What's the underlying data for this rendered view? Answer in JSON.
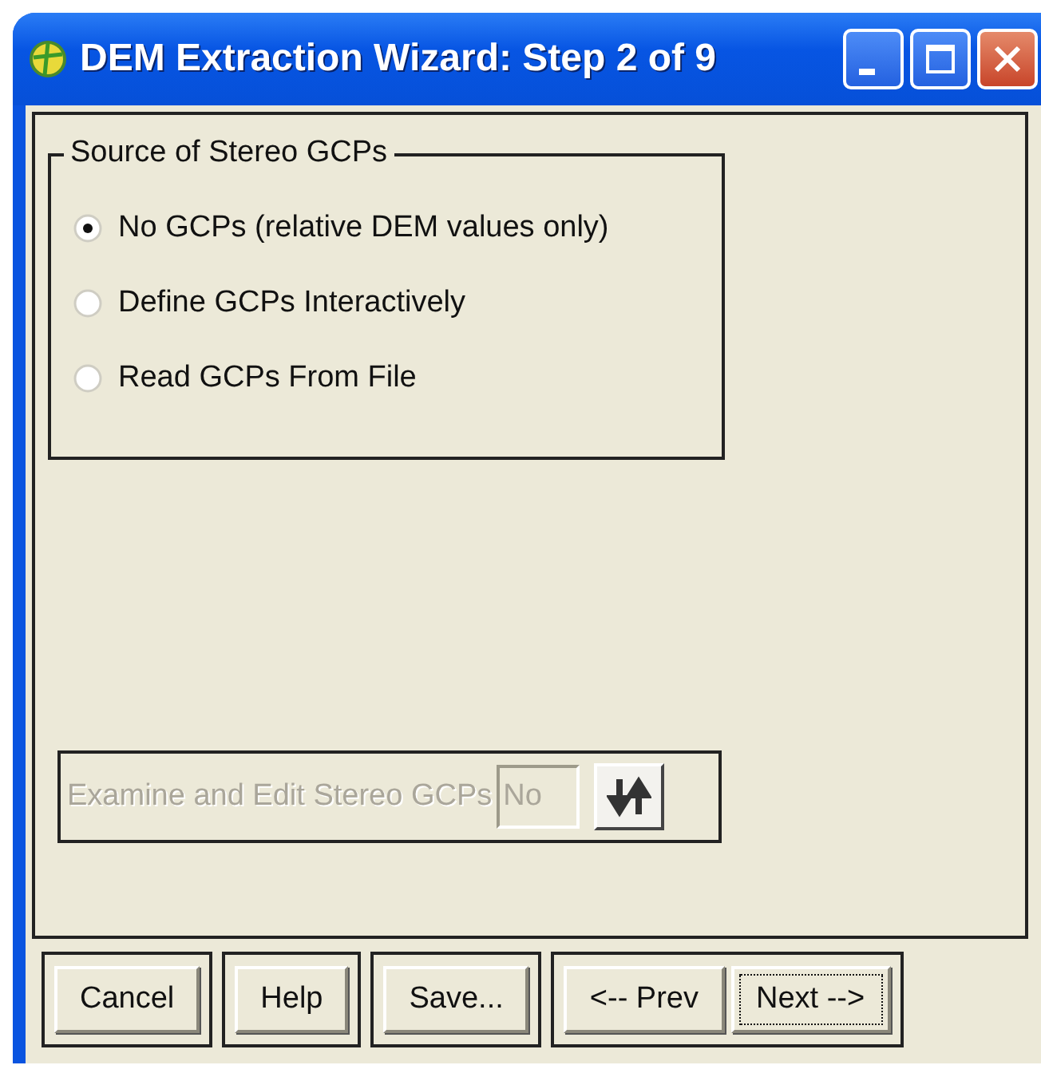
{
  "window": {
    "title": "DEM Extraction Wizard: Step 2 of 9"
  },
  "source_group": {
    "title": "Source of Stereo GCPs",
    "options": [
      {
        "label": "No GCPs (relative DEM values only)",
        "selected": true
      },
      {
        "label": "Define GCPs Interactively",
        "selected": false
      },
      {
        "label": "Read GCPs From File",
        "selected": false
      }
    ]
  },
  "examine": {
    "label": "Examine and Edit Stereo GCPs",
    "value": "No",
    "disabled": true
  },
  "button_groups": [
    [
      {
        "label": "Cancel",
        "focused": false
      }
    ],
    [
      {
        "label": "Help",
        "focused": false
      }
    ],
    [
      {
        "label": "Save...",
        "focused": false
      }
    ],
    [
      {
        "label": "<-- Prev",
        "focused": false
      },
      {
        "label": "Next -->",
        "focused": true
      }
    ]
  ]
}
